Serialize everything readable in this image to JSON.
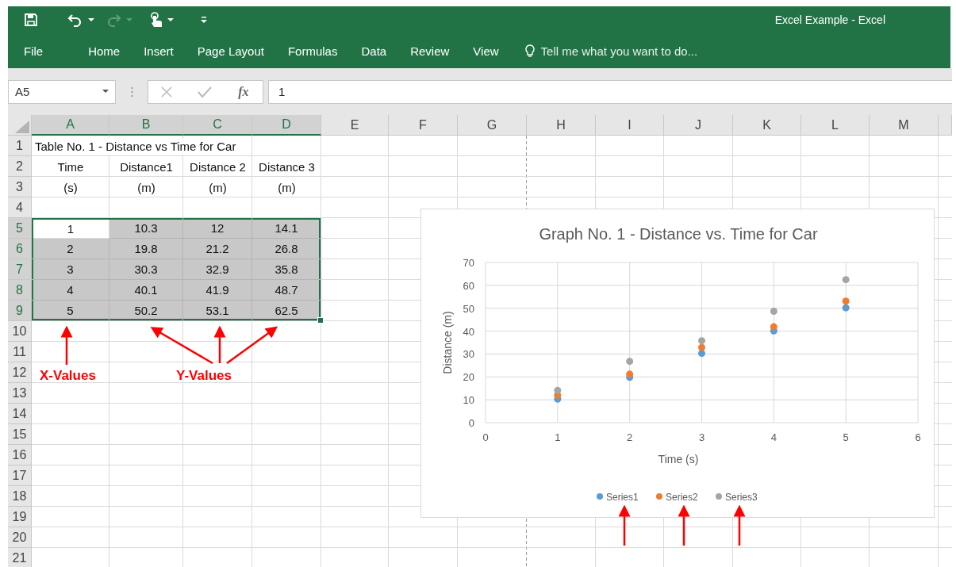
{
  "window": {
    "title": "Excel Example - Excel"
  },
  "ribbon_tabs": [
    {
      "label": "File"
    },
    {
      "label": "Home"
    },
    {
      "label": "Insert"
    },
    {
      "label": "Page Layout"
    },
    {
      "label": "Formulas"
    },
    {
      "label": "Data"
    },
    {
      "label": "Review"
    },
    {
      "label": "View"
    }
  ],
  "tell_me": {
    "placeholder": "Tell me what you want to do..."
  },
  "formula_bar": {
    "name_box": "A5",
    "function_label": "fx",
    "value": "1"
  },
  "sheet": {
    "columns": [
      {
        "label": "A",
        "selected": true
      },
      {
        "label": "B",
        "selected": true
      },
      {
        "label": "C",
        "selected": true
      },
      {
        "label": "D",
        "selected": true
      },
      {
        "label": "E",
        "selected": false
      },
      {
        "label": "F",
        "selected": false
      },
      {
        "label": "G",
        "selected": false
      },
      {
        "label": "H",
        "selected": false
      },
      {
        "label": "I",
        "selected": false
      },
      {
        "label": "J",
        "selected": false
      },
      {
        "label": "K",
        "selected": false
      },
      {
        "label": "L",
        "selected": false
      },
      {
        "label": "M",
        "selected": false
      }
    ],
    "rows": [
      {
        "label": "1",
        "selected": false,
        "title": "Table No. 1 - Distance vs Time for Car"
      },
      {
        "label": "2",
        "selected": false,
        "cells": [
          {
            "text": "Time"
          },
          {
            "text": "Distance1"
          },
          {
            "text": "Distance 2"
          },
          {
            "text": "Distance 3"
          }
        ]
      },
      {
        "label": "3",
        "selected": false,
        "cells": [
          {
            "text": "(s)"
          },
          {
            "text": "(m)"
          },
          {
            "text": "(m)"
          },
          {
            "text": "(m)"
          }
        ]
      },
      {
        "label": "4",
        "selected": false
      },
      {
        "label": "5",
        "selected": true,
        "cells": [
          {
            "text": "1",
            "in_range": true,
            "active": true
          },
          {
            "text": "10.3",
            "in_range": true,
            "active": false
          },
          {
            "text": "12",
            "in_range": true,
            "active": false
          },
          {
            "text": "14.1",
            "in_range": true,
            "active": false
          }
        ]
      },
      {
        "label": "6",
        "selected": true,
        "cells": [
          {
            "text": "2",
            "in_range": true,
            "active": false
          },
          {
            "text": "19.8",
            "in_range": true,
            "active": false
          },
          {
            "text": "21.2",
            "in_range": true,
            "active": false
          },
          {
            "text": "26.8",
            "in_range": true,
            "active": false
          }
        ]
      },
      {
        "label": "7",
        "selected": true,
        "cells": [
          {
            "text": "3",
            "in_range": true,
            "active": false
          },
          {
            "text": "30.3",
            "in_range": true,
            "active": false
          },
          {
            "text": "32.9",
            "in_range": true,
            "active": false
          },
          {
            "text": "35.8",
            "in_range": true,
            "active": false
          }
        ]
      },
      {
        "label": "8",
        "selected": true,
        "cells": [
          {
            "text": "4",
            "in_range": true,
            "active": false
          },
          {
            "text": "40.1",
            "in_range": true,
            "active": false
          },
          {
            "text": "41.9",
            "in_range": true,
            "active": false
          },
          {
            "text": "48.7",
            "in_range": true,
            "active": false
          }
        ]
      },
      {
        "label": "9",
        "selected": true,
        "cells": [
          {
            "text": "5",
            "in_range": true,
            "active": false
          },
          {
            "text": "50.2",
            "in_range": true,
            "active": false
          },
          {
            "text": "53.1",
            "in_range": true,
            "active": false
          },
          {
            "text": "62.5",
            "in_range": true,
            "active": false
          }
        ]
      },
      {
        "label": "10",
        "selected": false
      },
      {
        "label": "11",
        "selected": false
      },
      {
        "label": "12",
        "selected": false
      },
      {
        "label": "13",
        "selected": false
      },
      {
        "label": "14",
        "selected": false
      },
      {
        "label": "15",
        "selected": false
      },
      {
        "label": "16",
        "selected": false
      },
      {
        "label": "17",
        "selected": false
      },
      {
        "label": "18",
        "selected": false
      },
      {
        "label": "19",
        "selected": false
      },
      {
        "label": "20",
        "selected": false
      },
      {
        "label": "21",
        "selected": false
      }
    ]
  },
  "annotations": [
    {
      "text": "X-Values"
    },
    {
      "text": "Y-Values"
    }
  ],
  "chart": {
    "chart_data": {
      "type": "scatter",
      "title": "Graph No. 1 - Distance vs. Time for Car",
      "xlabel": "Time (s)",
      "ylabel": "Distance (m)",
      "x": [
        1,
        2,
        3,
        4,
        5
      ],
      "series": [
        {
          "name": "Series1",
          "color": "#5b9bd5",
          "values": [
            10.3,
            19.8,
            30.3,
            40.1,
            50.2
          ]
        },
        {
          "name": "Series2",
          "color": "#ed7d31",
          "values": [
            12,
            21.2,
            32.9,
            41.9,
            53.1
          ]
        },
        {
          "name": "Series3",
          "color": "#a5a5a5",
          "values": [
            14.1,
            26.8,
            35.8,
            48.7,
            62.5
          ]
        }
      ],
      "grid": true,
      "legend": true,
      "xlim": [
        0,
        6
      ],
      "ylim": [
        0,
        70
      ],
      "xticks": [
        {
          "value": 0,
          "label": "0"
        },
        {
          "value": 1,
          "label": "1"
        },
        {
          "value": 2,
          "label": "2"
        },
        {
          "value": 3,
          "label": "3"
        },
        {
          "value": 4,
          "label": "4"
        },
        {
          "value": 5,
          "label": "5"
        },
        {
          "value": 6,
          "label": "6"
        }
      ],
      "yticks": [
        {
          "value": 0,
          "label": "0"
        },
        {
          "value": 10,
          "label": "10"
        },
        {
          "value": 20,
          "label": "20"
        },
        {
          "value": 30,
          "label": "30"
        },
        {
          "value": 40,
          "label": "40"
        },
        {
          "value": 50,
          "label": "50"
        },
        {
          "value": 60,
          "label": "60"
        },
        {
          "value": 70,
          "label": "70"
        }
      ]
    }
  }
}
